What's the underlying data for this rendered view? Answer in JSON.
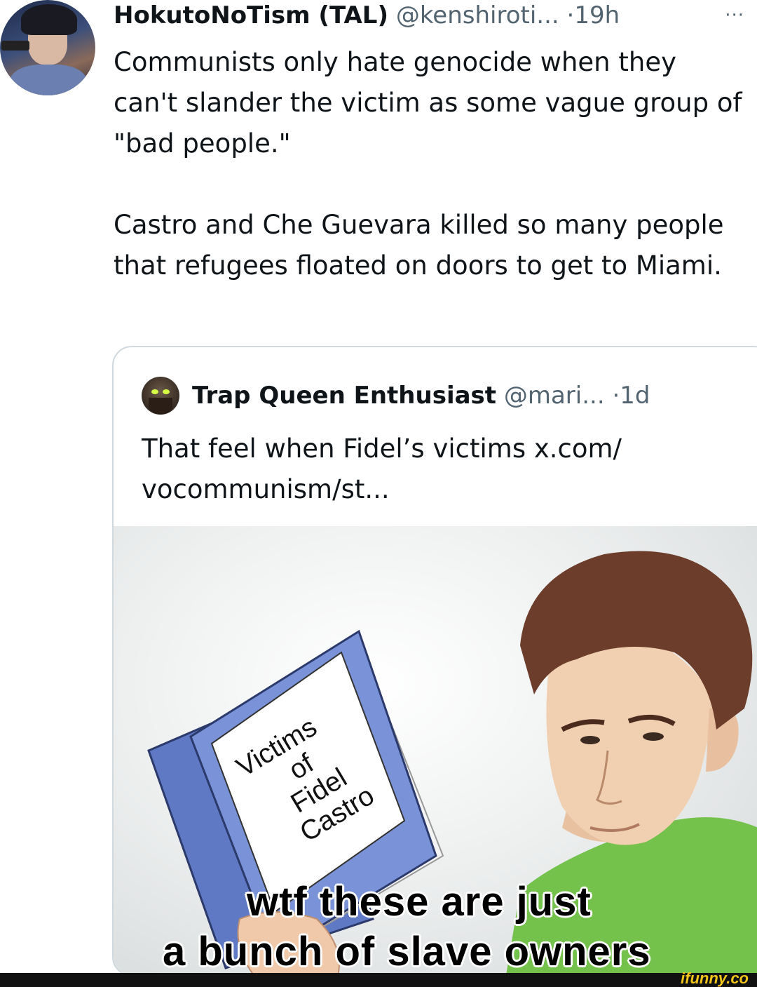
{
  "tweet": {
    "display_name": "HokutoNoTism (TAL)",
    "handle": "@kenshiroti...",
    "separator": "·",
    "time": "19h",
    "more_icon": "···",
    "paragraph_1": "Communists only hate genocide when they can't slander the victim as some vague group of \"bad people.\"",
    "paragraph_2": "Castro and Che Guevara killed so many people that refugees floated on doors to get to Miami."
  },
  "quote": {
    "display_name": "Trap Queen Enthusiast",
    "handle": "@mari...",
    "separator": "·",
    "time": "1d",
    "text": "That feel when Fidel’s victims x.com/\nvocommunism/st...",
    "meme": {
      "book_lines": [
        "Victims",
        "of",
        "Fidel",
        "Castro"
      ],
      "caption_line_1": "wtf these are just",
      "caption_line_2": "a bunch of slave owners"
    }
  },
  "watermark": "ifunny.co",
  "icons": {
    "more": "more-horizontal-icon",
    "avatar": "user-avatar",
    "quote_avatar": "quoted-user-avatar"
  },
  "colors": {
    "text": "#0f1419",
    "secondary": "#536471",
    "card_border": "#cfd9de",
    "book_blue": "#7a93d8",
    "shirt_green": "#74c14c",
    "watermark": "#f0c419"
  }
}
